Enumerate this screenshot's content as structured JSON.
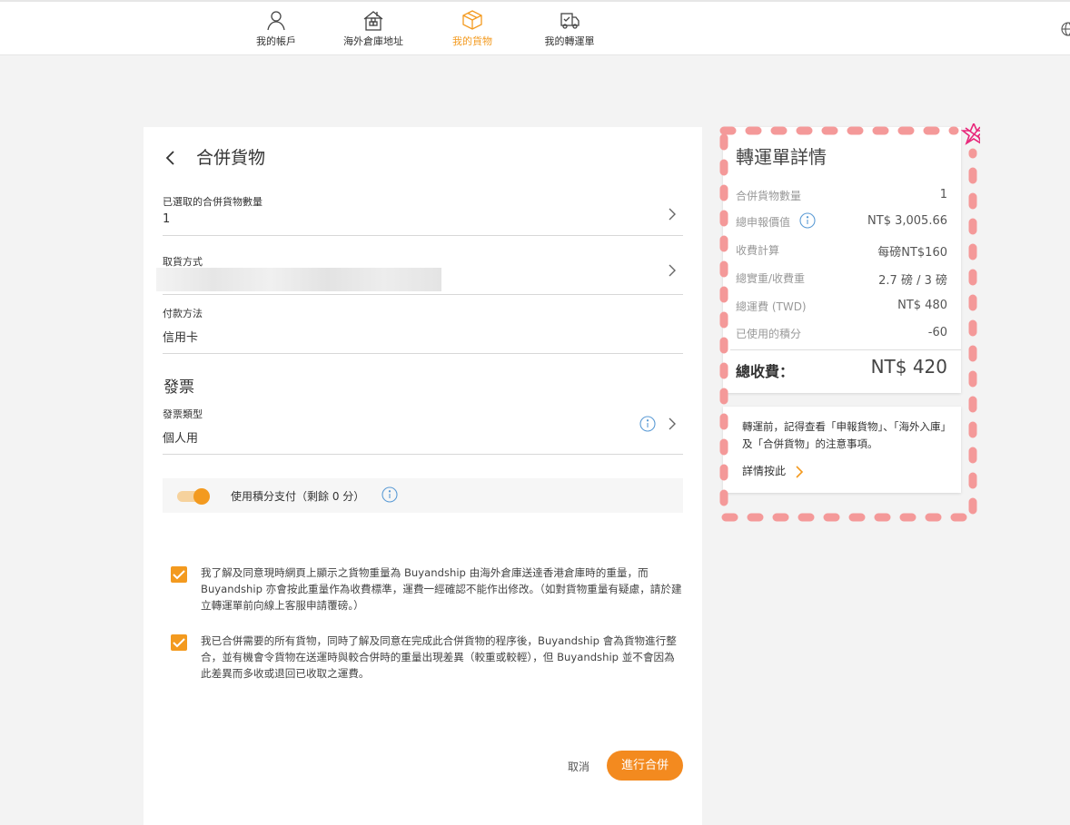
{
  "nav": {
    "items": [
      {
        "label": "我的帳戶",
        "icon": "user-icon"
      },
      {
        "label": "海外倉庫地址",
        "icon": "warehouse-icon"
      },
      {
        "label": "我的貨物",
        "icon": "package-icon",
        "active": true
      },
      {
        "label": "我的轉運單",
        "icon": "delivery-icon"
      }
    ],
    "globe_icon": "globe-icon"
  },
  "colors": {
    "accent": "#f39a1f",
    "button": "#f38a1f",
    "annotation": "#f08a8a"
  },
  "form": {
    "title": "合併貨物",
    "selected_count_label": "已選取的合併貨物數量",
    "selected_count_value": "1",
    "pickup_label": "取貨方式",
    "payment_label": "付款方法",
    "payment_value": "信用卡",
    "invoice_section": "發票",
    "invoice_type_label": "發票類型",
    "invoice_type_value": "個人用",
    "points_label": "使用積分支付（剩餘 0 分）",
    "points_toggle_on": true,
    "agree1": "我了解及同意現時網頁上顯示之貨物重量為 Buyandship 由海外倉庫送達香港倉庫時的重量，而 Buyandship 亦會按此重量作為收費標準，運費一經確認不能作出修改。（如對貨物重量有疑慮，請於建立轉運單前向線上客服申請覆磅。）",
    "agree2": "我已合併需要的所有貨物，同時了解及同意在完成此合併貨物的程序後，Buyandship 會為貨物進行整合，並有機會令貨物在送運時與較合併時的重量出現差異（較重或較輕），但 Buyandship 並不會因為此差異而多收或退回已收取之運費。",
    "agree1_checked": true,
    "agree2_checked": true,
    "cancel": "取消",
    "submit": "進行合併"
  },
  "summary": {
    "title": "轉運單詳情",
    "rows": [
      {
        "label": "合併貨物數量",
        "value": "1"
      },
      {
        "label": "總申報價值",
        "value": "NT$ 3,005.66"
      },
      {
        "label": "收費計算",
        "value": "每磅NT$160"
      },
      {
        "label": "總實重/收費重",
        "value": "2.7 磅 / 3 磅"
      },
      {
        "label": "總運費 (TWD)",
        "value": "NT$ 480"
      },
      {
        "label": "已使用的積分",
        "value": "-60"
      }
    ],
    "total_label": "總收費：",
    "total_value": "NT$ 420"
  },
  "note": {
    "text": "轉運前，記得查看「申報貨物」、「海外入庫」及「合併貨物」的注意事項。",
    "link": "詳情按此"
  }
}
